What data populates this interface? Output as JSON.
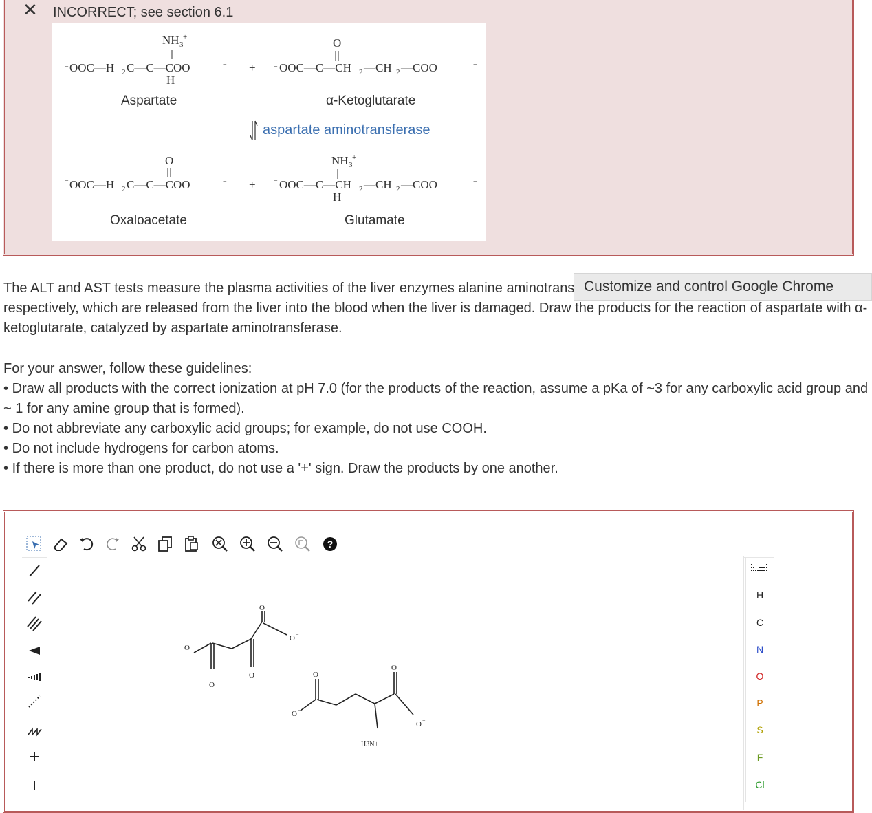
{
  "feedback": {
    "mark": "✕",
    "message": "INCORRECT; see section 6.1"
  },
  "figure": {
    "aspartate_label": "Aspartate",
    "akg_label": "α-Ketoglutarate",
    "enzyme_label": "aspartate aminotransferase",
    "oxaloacetate_label": "Oxaloacetate",
    "glutamate_label": "Glutamate",
    "plus": "+"
  },
  "tooltip": "Customize and control Google Chrome",
  "question": {
    "intro": "The ALT and AST tests measure the plasma activities of the liver enzymes alanine aminotransferase and aspartate aminotransferase, respectively, which are released from the liver into the blood when the liver is damaged. Draw the products for the reaction of aspartate with α-ketoglutarate, catalyzed by aspartate aminotransferase.",
    "guidelines_title": "For your answer, follow these guidelines:",
    "guidelines": [
      "Draw all products with the correct ionization at pH 7.0 (for the products of the reaction, assume a pKa of ~3 for any carboxylic acid group and ~ 1 for any amine group that is formed).",
      "Do not abbreviate any carboxylic acid groups; for example, do not use COOH.",
      "Do not include hydrogens for carbon atoms.",
      "If there is more than one product, do not use a '+' sign. Draw the products by one another."
    ]
  },
  "editor": {
    "top_tools": [
      "select-icon",
      "eraser-icon",
      "undo-icon",
      "redo-icon",
      "cut-icon",
      "copy-icon",
      "paste-icon",
      "zoom-reset-icon",
      "zoom-in-icon",
      "zoom-out-icon",
      "clean-icon",
      "help-icon"
    ],
    "left_tools": [
      "single-bond-icon",
      "double-bond-icon",
      "triple-bond-icon",
      "wedge-bond-icon",
      "hash-bond-icon",
      "dash-bond-icon",
      "chain-icon",
      "positive-charge-icon",
      "negative-charge-icon"
    ],
    "elements": [
      "H",
      "C",
      "N",
      "O",
      "P",
      "S",
      "F",
      "Cl"
    ],
    "help_glyph": "?",
    "molecule_atoms": {
      "o_minus": "O",
      "h3n_plus": "H3N+"
    }
  }
}
